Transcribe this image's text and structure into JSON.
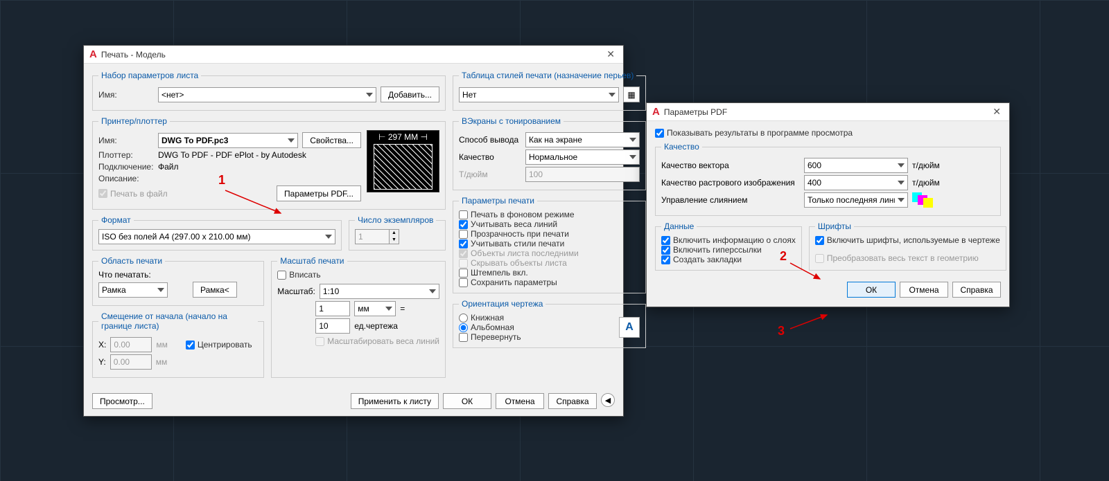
{
  "d1": {
    "title": "Печать - Модель",
    "pageSet": {
      "legend": "Набор параметров листа",
      "nameLbl": "Имя:",
      "nameVal": "<нет>",
      "addBtn": "Добавить..."
    },
    "printer": {
      "legend": "Принтер/плоттер",
      "nameLbl": "Имя:",
      "nameVal": "DWG To PDF.pc3",
      "propsBtn": "Свойства...",
      "plotterLbl": "Плоттер:",
      "plotterVal": "DWG To PDF - PDF ePlot - by Autodesk",
      "connLbl": "Подключение:",
      "connVal": "Файл",
      "descLbl": "Описание:",
      "toFile": "Печать в файл",
      "pdfBtn": "Параметры PDF...",
      "dim": "297 MM"
    },
    "format": {
      "legend": "Формат",
      "val": "ISO без полей A4 (297.00 x 210.00 мм)"
    },
    "copies": {
      "legend": "Число экземпляров",
      "val": "1"
    },
    "area": {
      "legend": "Область печати",
      "whatLbl": "Что печатать:",
      "whatVal": "Рамка",
      "frameBtn": "Рамка<"
    },
    "offset": {
      "legend": "Смещение от начала (начало на границе листа)",
      "xLbl": "X:",
      "xVal": "0.00",
      "yLbl": "Y:",
      "yVal": "0.00",
      "unit": "мм",
      "center": "Центрировать"
    },
    "scale": {
      "legend": "Масштаб печати",
      "fit": "Вписать",
      "scaleLbl": "Масштаб:",
      "scaleVal": "1:10",
      "v1": "1",
      "unit": "мм",
      "eq": "=",
      "v2": "10",
      "unitDraw": "ед.чертежа",
      "weights": "Масштабировать веса линий"
    },
    "styles": {
      "legend": "Таблица стилей печати (назначение перьев)",
      "val": "Нет"
    },
    "shade": {
      "legend": "ВЭкраны с тонированием",
      "methodLbl": "Способ вывода",
      "methodVal": "Как на экране",
      "qualLbl": "Качество",
      "qualVal": "Нормальное",
      "dpiLbl": "Т/дюйм",
      "dpiVal": "100"
    },
    "opts": {
      "legend": "Параметры печати",
      "bg": "Печать в фоновом режиме",
      "lw": "Учитывать веса линий",
      "tr": "Прозрачность при печати",
      "ps": "Учитывать стили печати",
      "last": "Объекты листа последними",
      "hide": "Скрывать объекты листа",
      "stamp": "Штемпель вкл.",
      "save": "Сохранить параметры"
    },
    "orient": {
      "legend": "Ориентация чертежа",
      "port": "Книжная",
      "land": "Альбомная",
      "flip": "Перевернуть"
    },
    "btm": {
      "preview": "Просмотр...",
      "apply": "Применить к листу",
      "ok": "ОК",
      "cancel": "Отмена",
      "help": "Справка"
    }
  },
  "d2": {
    "title": "Параметры PDF",
    "show": "Показывать результаты в программе просмотра",
    "qual": {
      "legend": "Качество",
      "vecLbl": "Качество вектора",
      "vecVal": "600",
      "rasLbl": "Качество растрового изображения",
      "rasVal": "400",
      "mergeLbl": "Управление слиянием",
      "mergeVal": "Только последняя линия",
      "dpi": "т/дюйм"
    },
    "data": {
      "legend": "Данные",
      "layers": "Включить информацию о слоях",
      "links": "Включить гиперссылки",
      "bm": "Создать закладки"
    },
    "fonts": {
      "legend": "Шрифты",
      "inc": "Включить шрифты, используемые в чертеже",
      "geom": "Преобразовать весь текст в геометрию"
    },
    "ok": "ОК",
    "cancel": "Отмена",
    "help": "Справка"
  },
  "annot": {
    "n1": "1",
    "n2": "2",
    "n3": "3"
  }
}
